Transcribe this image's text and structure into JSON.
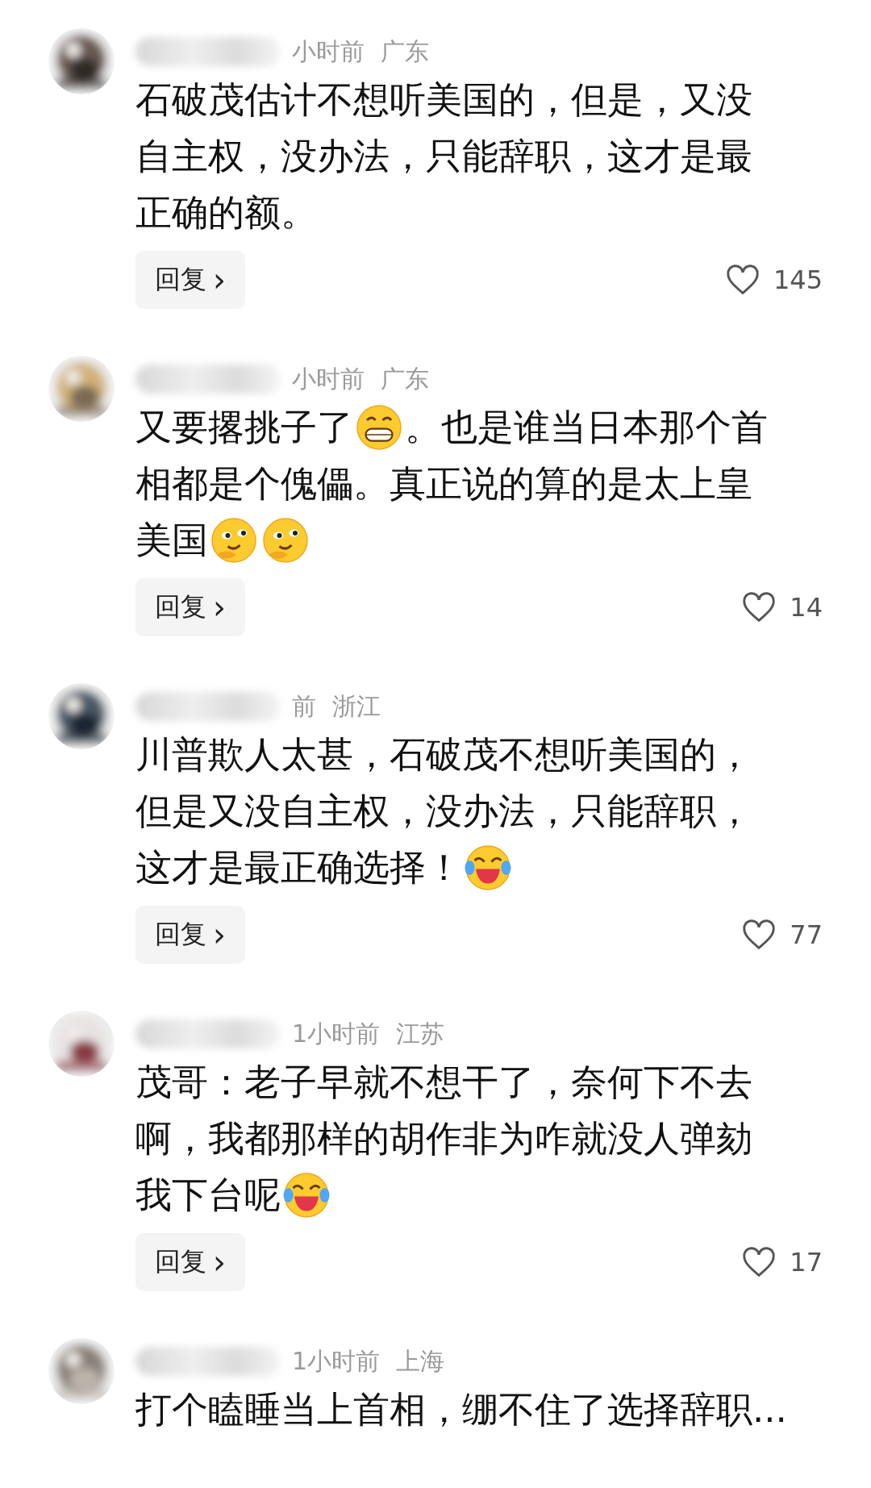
{
  "comments": [
    {
      "meta": "小时前",
      "region": "广东",
      "lines": [
        [
          {
            "kind": "text",
            "text": "石破茂估计不想听美国的，但是，又没"
          }
        ],
        [
          {
            "kind": "text",
            "text": "自主权，没办法，只能辞职，这才是最"
          }
        ],
        [
          {
            "kind": "text",
            "text": "正确的额。"
          }
        ]
      ],
      "reply": "回复",
      "arrow": "›",
      "liked": false,
      "likes": "145"
    },
    {
      "meta": "小时前",
      "region": "广东",
      "lines": [
        [
          {
            "kind": "text",
            "text": "又要撂挑子了"
          },
          {
            "kind": "grin"
          },
          {
            "kind": "text",
            "text": "。也是谁当日本那个首"
          }
        ],
        [
          {
            "kind": "text",
            "text": "相都是个傀儡。真正说的算的是太上皇"
          }
        ],
        [
          {
            "kind": "text",
            "text": "美国"
          },
          {
            "kind": "smirk"
          },
          {
            "kind": "smirk"
          }
        ]
      ],
      "reply": "回复",
      "arrow": "›",
      "liked": false,
      "likes": "14"
    },
    {
      "meta": "前",
      "region": "浙江",
      "lines": [
        [
          {
            "kind": "text",
            "text": "川普欺人太甚，石破茂不想听美国的，"
          }
        ],
        [
          {
            "kind": "text",
            "text": "但是又没自主权，没办法，只能辞职，"
          }
        ],
        [
          {
            "kind": "text",
            "text": "这才是最正确选择！"
          },
          {
            "kind": "laughcry"
          }
        ]
      ],
      "reply": "回复",
      "arrow": "›",
      "liked": false,
      "likes": "77"
    },
    {
      "meta": "1小时前",
      "region": "江苏",
      "lines": [
        [
          {
            "kind": "text",
            "text": "茂哥：老子早就不想干了，奈何下不去"
          }
        ],
        [
          {
            "kind": "text",
            "text": "啊，我都那样的胡作非为咋就没人弹劾"
          }
        ],
        [
          {
            "kind": "text",
            "text": "我下台呢"
          },
          {
            "kind": "laughcry"
          }
        ]
      ],
      "reply": "回复",
      "arrow": "›",
      "liked": false,
      "likes": "17"
    },
    {
      "meta": "1小时前",
      "region": "上海",
      "lines": [
        [
          {
            "kind": "text",
            "text": "打个瞌睡当上首相，绷不住了选择辞职..."
          }
        ]
      ]
    }
  ]
}
